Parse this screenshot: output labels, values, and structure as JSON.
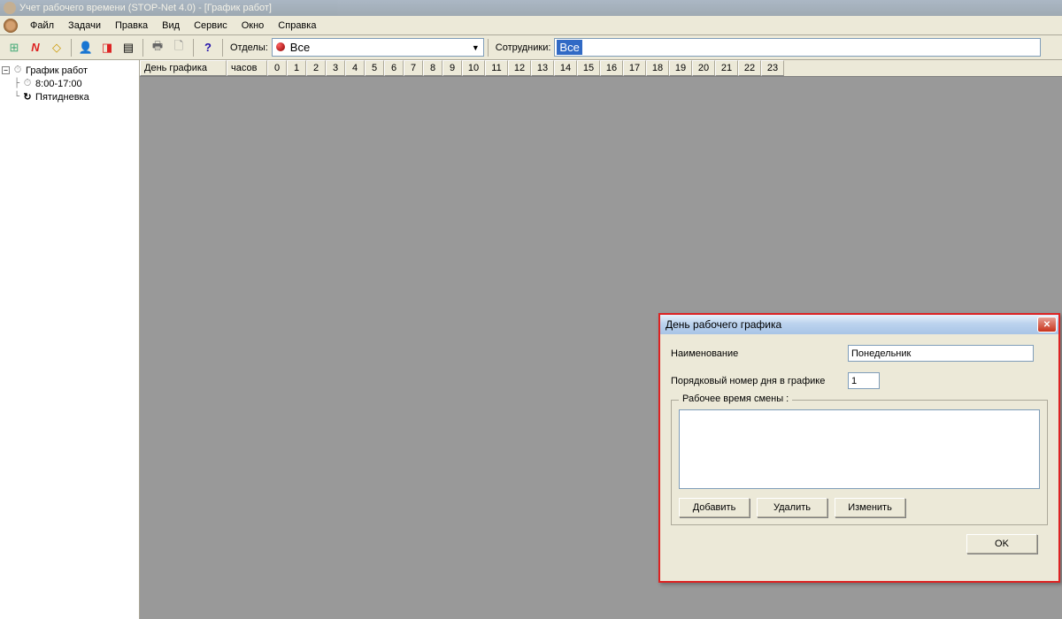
{
  "window": {
    "title": "Учет рабочего времени (STOP-Net 4.0) - [График работ]"
  },
  "menu": [
    "Файл",
    "Задачи",
    "Правка",
    "Вид",
    "Сервис",
    "Окно",
    "Справка"
  ],
  "toolbar": {
    "dept_label": "Отделы:",
    "dept_value": "Все",
    "emp_label": "Сотрудники:",
    "emp_value": "Все"
  },
  "tree": {
    "root": "График работ",
    "children": [
      "8:00-17:00",
      "Пятидневка"
    ]
  },
  "grid": {
    "col_day": "День графика",
    "col_hours": "часов",
    "hours": [
      "0",
      "1",
      "2",
      "3",
      "4",
      "5",
      "6",
      "7",
      "8",
      "9",
      "10",
      "11",
      "12",
      "13",
      "14",
      "15",
      "16",
      "17",
      "18",
      "19",
      "20",
      "21",
      "22",
      "23"
    ]
  },
  "dialog": {
    "title": "День рабочего графика",
    "name_label": "Наименование",
    "name_value": "Понедельник",
    "order_label": "Порядковый номер дня в графике",
    "order_value": "1",
    "shift_legend": "Рабочее время смены :",
    "btn_add": "Добавить",
    "btn_del": "Удалить",
    "btn_edit": "Изменить",
    "btn_ok": "OK"
  }
}
